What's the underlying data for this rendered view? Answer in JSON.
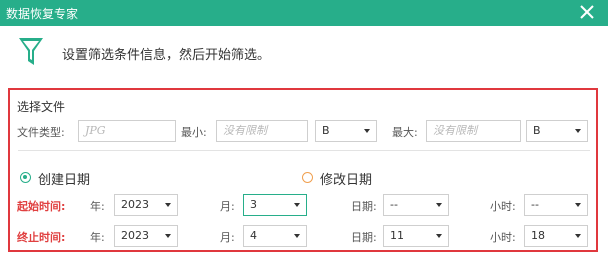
{
  "colors": {
    "accent": "#27ae8a",
    "alert_border": "#e0383e",
    "label_red": "#e04040",
    "radio_unchecked": "#f0a050"
  },
  "window": {
    "title": "数据恢复专家",
    "close_icon": "close-icon"
  },
  "hint": {
    "icon": "funnel-icon",
    "text": "设置筛选条件信息，然后开始筛选。"
  },
  "file_section": {
    "title": "选择文件",
    "file_type_label": "文件类型:",
    "file_type_placeholder": "JPG",
    "min_label": "最小:",
    "min_placeholder": "没有限制",
    "min_unit": "B",
    "max_label": "最大:",
    "max_placeholder": "没有限制",
    "max_unit": "B"
  },
  "date_mode": {
    "created_label": "创建日期",
    "modified_label": "修改日期",
    "selected": "创建日期"
  },
  "start_time": {
    "label": "起始时间:",
    "year_label": "年:",
    "year_value": "2023",
    "month_label": "月:",
    "month_value": "3",
    "day_label": "日期:",
    "day_value": "--",
    "hour_label": "小时:",
    "hour_value": "--"
  },
  "end_time": {
    "label": "终止时间:",
    "year_label": "年:",
    "year_value": "2023",
    "month_label": "月:",
    "month_value": "4",
    "day_label": "日期:",
    "day_value": "11",
    "hour_label": "小时:",
    "hour_value": "18"
  }
}
